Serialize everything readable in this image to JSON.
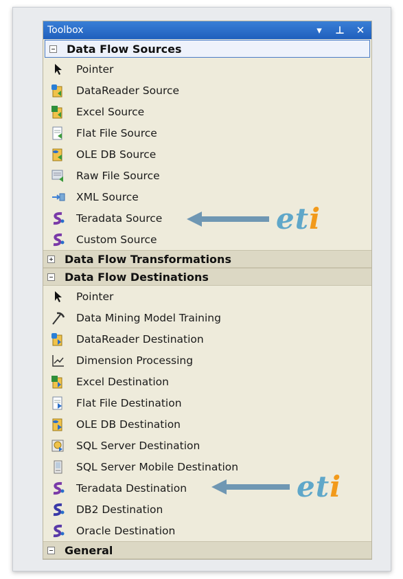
{
  "window": {
    "title": "Toolbox",
    "buttons": [
      {
        "name": "dropdown-icon",
        "glyph": "▾"
      },
      {
        "name": "pin-icon",
        "glyph": "⊥"
      },
      {
        "name": "close-icon",
        "glyph": "✕"
      }
    ]
  },
  "sections": [
    {
      "name": "data-flow-sources",
      "label": "Data Flow Sources",
      "expanded": true,
      "items": [
        {
          "label": "Pointer",
          "icon": "pointer-icon"
        },
        {
          "label": "DataReader Source",
          "icon": "datareader-source-icon"
        },
        {
          "label": "Excel Source",
          "icon": "excel-source-icon"
        },
        {
          "label": "Flat File Source",
          "icon": "flat-file-source-icon"
        },
        {
          "label": "OLE DB Source",
          "icon": "ole-db-source-icon"
        },
        {
          "label": "Raw File Source",
          "icon": "raw-file-source-icon"
        },
        {
          "label": "XML Source",
          "icon": "xml-source-icon"
        },
        {
          "label": "Teradata Source",
          "icon": "teradata-icon"
        },
        {
          "label": "Custom Source",
          "icon": "custom-source-icon"
        }
      ]
    },
    {
      "name": "data-flow-transformations",
      "label": "Data Flow Transformations",
      "expanded": false,
      "items": []
    },
    {
      "name": "data-flow-destinations",
      "label": "Data Flow Destinations",
      "expanded": true,
      "items": [
        {
          "label": "Pointer",
          "icon": "pointer-icon"
        },
        {
          "label": "Data Mining Model Training",
          "icon": "data-mining-icon"
        },
        {
          "label": "DataReader Destination",
          "icon": "datareader-destination-icon"
        },
        {
          "label": "Dimension Processing",
          "icon": "dimension-processing-icon"
        },
        {
          "label": "Excel Destination",
          "icon": "excel-destination-icon"
        },
        {
          "label": "Flat File Destination",
          "icon": "flat-file-destination-icon"
        },
        {
          "label": "OLE DB Destination",
          "icon": "ole-db-destination-icon"
        },
        {
          "label": "SQL Server Destination",
          "icon": "sql-server-destination-icon"
        },
        {
          "label": "SQL Server Mobile Destination",
          "icon": "sql-server-mobile-destination-icon"
        },
        {
          "label": "Teradata Destination",
          "icon": "teradata-icon"
        },
        {
          "label": "DB2 Destination",
          "icon": "db2-icon"
        },
        {
          "label": "Oracle Destination",
          "icon": "oracle-icon"
        }
      ]
    },
    {
      "name": "general",
      "label": "General",
      "expanded": true,
      "items": []
    }
  ],
  "annotations": [
    {
      "name": "eti-logo-sources",
      "text_e": "e",
      "text_t": "t",
      "text_i": "i"
    },
    {
      "name": "eti-logo-destinations",
      "text_e": "e",
      "text_t": "t",
      "text_i": "i"
    }
  ],
  "colors": {
    "titlebar": "#2a6fca",
    "panel_bg": "#eeebdb",
    "header_bg": "#dcd8c4",
    "arrow": "#6f97b3",
    "eti_blue": "#5fa7c9",
    "eti_orange": "#f29a1b"
  }
}
